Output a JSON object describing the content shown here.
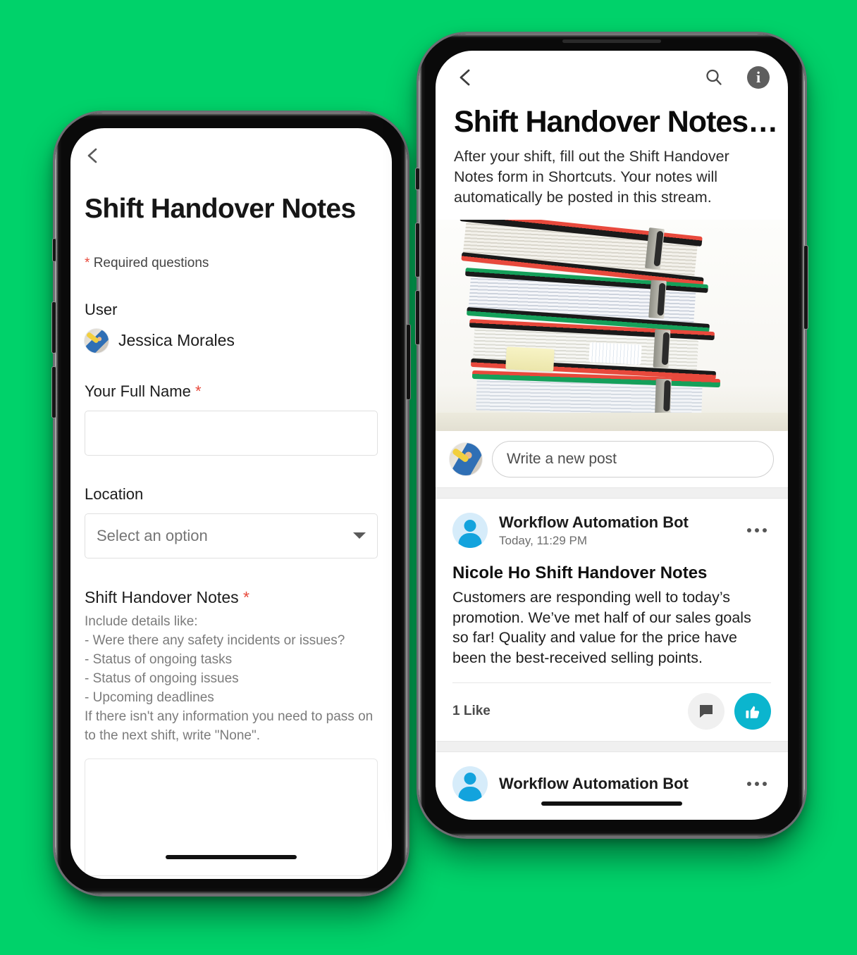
{
  "background_color": "#00d26a",
  "left_phone": {
    "name": "shortcuts-form-phone",
    "nav": {
      "back_icon": "chevron-left-icon"
    },
    "title": "Shift Handover Notes",
    "required_note": {
      "star": "*",
      "text": "Required questions"
    },
    "fields": [
      {
        "label": "User",
        "type": "user",
        "value": "Jessica Morales",
        "avatar": "user-avatar-photo"
      },
      {
        "label": "Your Full Name",
        "required_marker": "*",
        "type": "text",
        "value": "",
        "placeholder": ""
      },
      {
        "label": "Location",
        "type": "select",
        "value": "",
        "placeholder": "Select an option",
        "caret_icon": "caret-down-icon"
      },
      {
        "label": "Shift Handover Notes",
        "required_marker": "*",
        "type": "textarea",
        "help": "Include details like:\n- Were there any safety incidents or issues?\n- Status of ongoing tasks\n- Status of ongoing issues\n- Upcoming deadlines\nIf there isn't any information you need to pass on to the next shift, write \"None\".",
        "value": "",
        "placeholder": ""
      }
    ]
  },
  "right_phone": {
    "name": "stream-feed-phone",
    "nav": {
      "back_icon": "chevron-left-icon",
      "search_icon": "search-icon",
      "info_icon": "info-circle-icon",
      "info_glyph": "i"
    },
    "title": "Shift Handover Notes…",
    "description": "After your shift, fill out the Shift Handover Notes form in Shortcuts. Your notes will automatically be posted in this stream.",
    "hero_image_alt": "stack-of-ring-binders",
    "composer": {
      "avatar": "current-user-avatar",
      "placeholder": "Write a new post"
    },
    "posts": [
      {
        "avatar": "bot-avatar",
        "author": "Workflow Automation Bot",
        "timestamp": "Today, 11:29 PM",
        "menu_icon": "more-options-icon",
        "title": "Nicole Ho Shift Handover Notes",
        "body": "Customers are responding well to today’s promotion. We’ve met half of our sales goals so far! Quality and value for the price have been the best-received selling points.",
        "likes_label": "1 Like",
        "comment_icon": "comment-icon",
        "like_icon": "thumbs-up-icon"
      },
      {
        "avatar": "bot-avatar",
        "author": "Workflow Automation Bot",
        "menu_icon": "more-options-icon"
      }
    ],
    "accent_color": "#0bb5ce"
  }
}
